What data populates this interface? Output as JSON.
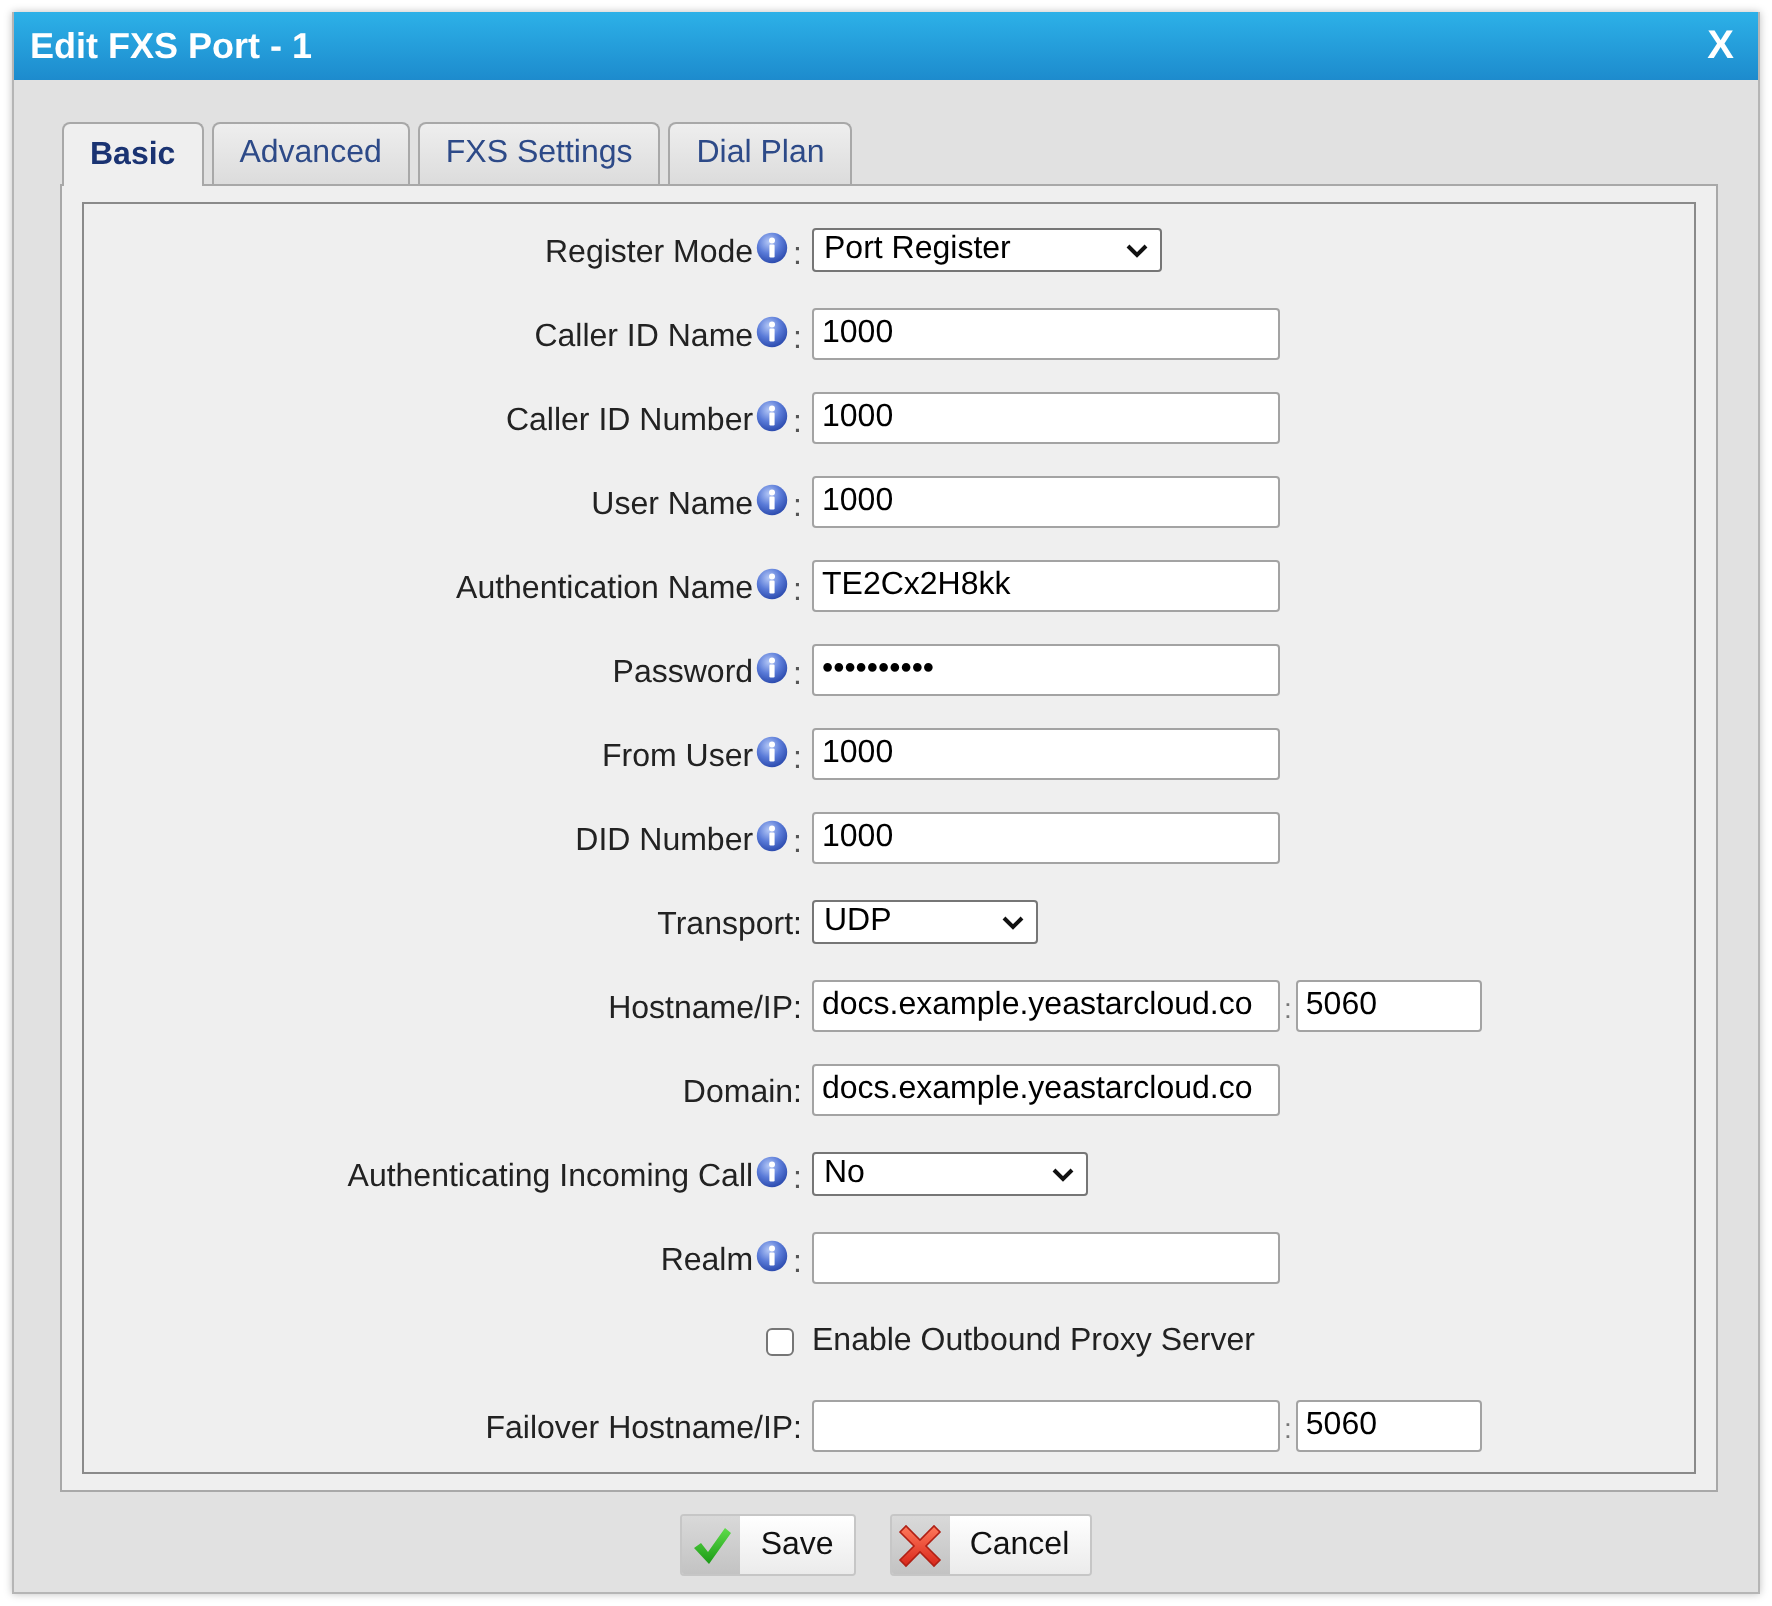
{
  "window": {
    "title": "Edit FXS Port - 1",
    "close": "X"
  },
  "tabs": [
    {
      "label": "Basic",
      "selected": true
    },
    {
      "label": "Advanced",
      "selected": false
    },
    {
      "label": "FXS Settings",
      "selected": false
    },
    {
      "label": "Dial Plan",
      "selected": false
    }
  ],
  "form": {
    "rows": [
      {
        "kind": "select",
        "label": "Register Mode",
        "info": true,
        "colon": ":",
        "value": "Port Register"
      },
      {
        "kind": "text",
        "label": "Caller ID Name",
        "info": true,
        "colon": ":",
        "value": "1000"
      },
      {
        "kind": "text",
        "label": "Caller ID Number",
        "info": true,
        "colon": ":",
        "value": "1000"
      },
      {
        "kind": "text",
        "label": "User Name",
        "info": true,
        "colon": ":",
        "value": "1000"
      },
      {
        "kind": "text",
        "label": "Authentication Name",
        "info": true,
        "colon": ":",
        "value": "TE2Cx2H8kk"
      },
      {
        "kind": "text",
        "label": "Password",
        "info": true,
        "colon": ":",
        "value": "••••••••••"
      },
      {
        "kind": "text",
        "label": "From User",
        "info": true,
        "colon": ":",
        "value": "1000"
      },
      {
        "kind": "text",
        "label": "DID Number",
        "info": true,
        "colon": ":",
        "value": "1000"
      },
      {
        "kind": "select",
        "label": "Transport:",
        "info": false,
        "value": "UDP"
      },
      {
        "kind": "host",
        "label": "Hostname/IP:",
        "info": false,
        "value": "docs.example.yeastarcloud.co",
        "separator": ":",
        "port": "5060"
      },
      {
        "kind": "text",
        "label": "Domain:",
        "info": false,
        "value": "docs.example.yeastarcloud.co"
      },
      {
        "kind": "select",
        "label": "Authenticating Incoming Call",
        "info": true,
        "colon": ":",
        "value": "No"
      },
      {
        "kind": "text",
        "label": "Realm",
        "info": true,
        "colon": ":"
      },
      {
        "kind": "checkbox",
        "label": "Enable Outbound Proxy Server",
        "checked": false
      },
      {
        "kind": "host",
        "label": "Failover Hostname/IP:",
        "info": false,
        "separator": ":",
        "port": "5060"
      }
    ]
  },
  "buttons": [
    {
      "kind": "save",
      "label": "Save"
    },
    {
      "kind": "cancel",
      "label": "Cancel"
    }
  ]
}
